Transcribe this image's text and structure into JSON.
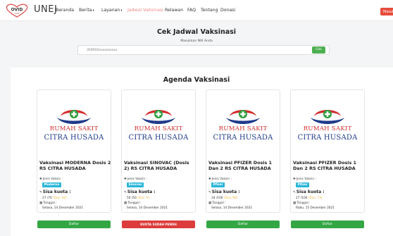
{
  "navbar": {
    "logo_text": "COVID CARE",
    "brand": "UNEJ",
    "items": [
      {
        "label": "Beranda"
      },
      {
        "label": "Berita",
        "caret": "▾"
      },
      {
        "label": "Layanan",
        "caret": "▾"
      },
      {
        "label": "Jadwal Vaksinasi"
      },
      {
        "label": "Relawan"
      },
      {
        "label": "FAQ"
      },
      {
        "label": "Tentang"
      },
      {
        "label": "Donasi"
      }
    ],
    "masuk_label": "Masuk"
  },
  "cek": {
    "title": "Cek Jadwal Vaksinasi",
    "subtitle": "Masukkan NIK Anda",
    "nik_value": "35091Dxxxxxxxxxx",
    "button": "Cek"
  },
  "agenda": {
    "title": "Agenda Vaksinasi",
    "hospital_line1": "Rumah Sakit",
    "hospital_line2": "Citra Husada",
    "cards": [
      {
        "title": "Vaksinasi MODERNA Dosis 2 RS CITRA HUSADA",
        "jenis_label": "Jenis Vaksin :",
        "vaccine": "Moderna",
        "sisa_label": "Sisa kuota :",
        "sisa": "27 /70",
        "dosis": "(Dos. 42)",
        "tanggal_label": "Tanggal :",
        "tanggal": "Selasa, 14 Desember 2021",
        "button": "Daftar",
        "button_color": "#34a745"
      },
      {
        "title": "Vaksinasi SINOVAC (Dosis 2) RS CITRA HUSADA",
        "jenis_label": "Jenis Vaksin :",
        "vaccine": "Sinovac",
        "sisa_label": "Sisa kuota :",
        "sisa": "50 /50",
        "dosis": "(Dos. 0)",
        "tanggal_label": "Tanggal :",
        "tanggal": "Selasa, 14 Desember 2021",
        "button": "KUOTA SUDAH PENUH",
        "button_color": "#dc3c3c"
      },
      {
        "title": "Vaksinasi PFIZER Dosis 1 Dan 2 RS CITRA HUSADA",
        "jenis_label": "Jenis Vaksin :",
        "vaccine": "Pfizer",
        "sisa_label": "Sisa kuota :",
        "sisa": "34 /100",
        "dosis": "(Dos. 66)",
        "tanggal_label": "Tanggal :",
        "tanggal": "Selasa, 14 Desember 2021",
        "button": "Daftar",
        "button_color": "#34a745"
      },
      {
        "title": "Vaksinasi PFIZER Dosis 1 Dan 2 RS CITRA HUSADA",
        "jenis_label": "Jenis Vaksin :",
        "vaccine": "Pfizer",
        "sisa_label": "Sisa kuota :",
        "sisa": "27 /100",
        "dosis": "(Dos. 73)",
        "tanggal_label": "Tanggal :",
        "tanggal": "Rabu, 15 Desember 2021",
        "button": "Daftar",
        "button_color": "#34a745"
      }
    ]
  },
  "icons": {
    "vaccine": "syringe-icon",
    "quota": "pencil-icon",
    "date": "calendar-icon"
  },
  "colors": {
    "badge": "#2bb6d8",
    "logo_red": "#d32f2f",
    "logo_blue": "#1e3a8a",
    "active_nav": "#f08a8a"
  }
}
